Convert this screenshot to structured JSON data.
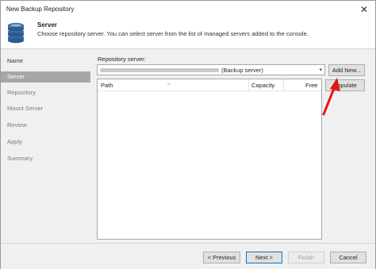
{
  "window": {
    "title": "New Backup Repository",
    "close_glyph": "✕"
  },
  "header": {
    "step_title": "Server",
    "step_description": "Choose repository server. You can select server from the list of managed servers added to the console."
  },
  "sidebar": {
    "items": [
      {
        "label": "Name",
        "state": "completed"
      },
      {
        "label": "Server",
        "state": "active"
      },
      {
        "label": "Repository",
        "state": "pending"
      },
      {
        "label": "Mount Server",
        "state": "pending"
      },
      {
        "label": "Review",
        "state": "pending"
      },
      {
        "label": "Apply",
        "state": "pending"
      },
      {
        "label": "Summary",
        "state": "pending"
      }
    ]
  },
  "main": {
    "repository_server_label": "Repository server:",
    "server_select_value": "(Backup server)",
    "add_new_label": "Add New...",
    "populate_label": "Populate",
    "table": {
      "columns": [
        "Path",
        "Capacity",
        "Free"
      ],
      "rows": []
    }
  },
  "footer": {
    "previous_label": "< Previous",
    "next_label": "Next >",
    "finish_label": "Finish",
    "cancel_label": "Cancel"
  },
  "annotation": {
    "arrow_color": "#e0161b"
  },
  "colors": {
    "active_nav_bg": "#a6a6a6",
    "primary_border": "#0078d7",
    "icon_blue": "#3b6ea8"
  }
}
